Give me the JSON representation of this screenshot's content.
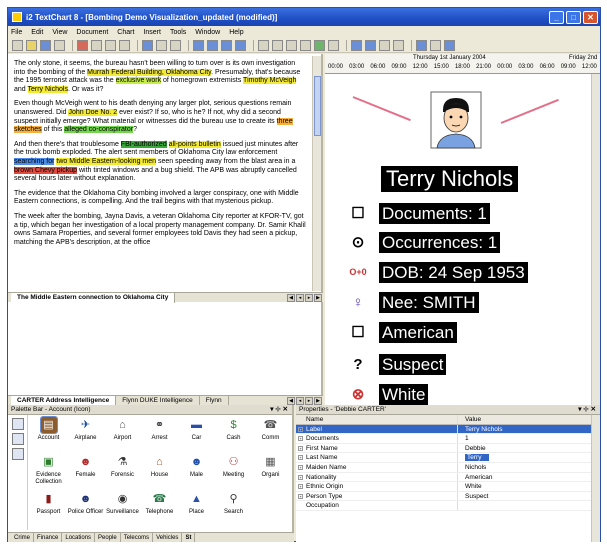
{
  "window": {
    "title": "i2 TextChart 8 - [Bombing Demo Visualization_updated (modified)]",
    "controls": [
      "_",
      "□",
      "✕"
    ]
  },
  "menu": [
    "File",
    "Edit",
    "View",
    "Document",
    "Chart",
    "Insert",
    "Tools",
    "Window",
    "Help"
  ],
  "document": {
    "para1_a": "The only stone, it seems, the bureau hasn't been willing to turn over is its own investigation into the bombing of the ",
    "para1_hl1": "Murrah Federal Building, Oklahoma City",
    "para1_b": ". Presumably, that's because the 1995 terrorist attack was the ",
    "para1_hl2": "exclusive work",
    "para1_c": " of homegrown extremists ",
    "para1_hl3": "Timothy McVeigh",
    "para1_d": " and ",
    "para1_hl4": "Terry Nichols",
    "para1_e": ". Or was it?",
    "para2_a": "Even though McVeigh went to his death denying any larger plot, serious questions remain unanswered. Did ",
    "para2_hl1": "John Doe No. 2",
    "para2_b": " ever exist? If so, who is he? If not, why did a second suspect initially emerge? What material or witnesses did the bureau use to create its ",
    "para2_hl2": "three sketches",
    "para2_c": " of this ",
    "para2_hl3": "alleged co-conspirator",
    "para2_d": "?",
    "para3_a": "And then there's that troublesome ",
    "para3_hl1": "FBI-authorized",
    "para3_b": " ",
    "para3_hl2": "all-points bulletin",
    "para3_c": " issued just minutes after the truck bomb exploded. The alert sent members of Oklahoma City law enforcement ",
    "para3_hl3": "searching for",
    "para3_d": " ",
    "para3_hl4": "two Middle Eastern-looking men",
    "para3_e": " seen speeding away from the blast area in a ",
    "para3_hl5": "brown Chevy pickup",
    "para3_f": " with tinted windows and a bug shield. The APB was abruptly cancelled several hours later without explanation.",
    "para4": "The evidence that the Oklahoma City bombing involved a larger conspiracy, one with Middle Eastern connections, is compelling. And the trail begins with that mysterious pickup.",
    "para5": "The week after the bombing, Jayna Davis, a veteran Oklahoma City reporter at KFOR-TV, got a tip, which began her investigation of a local property management company. Dr. Samir Khalil owns Samara Properties, and several former employees told Davis they had seen a pickup, matching the APB's description, at the office"
  },
  "doc_tabs": {
    "upper": "The Middle Eastern connection to Oklahoma City",
    "lower": [
      "CARTER Address Intelligence",
      "Flynn DUKE Intelligence",
      "Flynn"
    ]
  },
  "timeline": {
    "date1": "Thursday 1st January 2004",
    "date2": "Friday 2nd",
    "ticks": [
      "00:00",
      "03:00",
      "06:00",
      "09:00",
      "12:00",
      "15:00",
      "18:00",
      "21:00",
      "00:00",
      "03:00",
      "06:00",
      "09:00",
      "12:00"
    ]
  },
  "entity": {
    "name": "Terry Nichols",
    "attributes": [
      {
        "icon": "checkbox-icon",
        "glyph": "☐",
        "text": "Documents: 1"
      },
      {
        "icon": "target-icon",
        "glyph": "⊙",
        "text": "Occurrences: 1"
      },
      {
        "icon": "dob-icon",
        "glyph": "O+0",
        "text": "DOB: 24 Sep 1953"
      },
      {
        "icon": "female-symbol-icon",
        "glyph": "♀",
        "text": "Nee: SMITH"
      },
      {
        "icon": "checkbox-icon",
        "glyph": "☐",
        "text": "American"
      },
      {
        "icon": "question-icon",
        "glyph": "?",
        "text": "Suspect"
      },
      {
        "icon": "ethnic-icon",
        "glyph": "⊗",
        "text": "White"
      }
    ]
  },
  "palette": {
    "title": "Palette Bar - Account (Icon)",
    "items": [
      "Account",
      "Airplane",
      "Airport",
      "Arrest",
      "Car",
      "Cash",
      "Comm",
      "Evidence Collection",
      "Female",
      "Forensic",
      "House",
      "Male",
      "Meeting",
      "Organi",
      "Passport",
      "Police Officer",
      "Surveillance",
      "Telephone",
      "Place",
      "Search",
      ""
    ],
    "tabs": [
      "Crime",
      "Finance",
      "Locations",
      "People",
      "Telecoms",
      "Vehicles",
      "St"
    ]
  },
  "properties": {
    "title": "Properties - 'Debbie CARTER'",
    "col_name": "Name",
    "col_value": "Value",
    "rows": [
      {
        "name": "Label",
        "value": "Terry Nichols"
      },
      {
        "name": "Documents",
        "value": "1"
      },
      {
        "name": "First Name",
        "value": "Debbie"
      },
      {
        "name": "Last Name",
        "value": "Terry"
      },
      {
        "name": "Maiden Name",
        "value": "Nichols"
      },
      {
        "name": "Nationality",
        "value": "American"
      },
      {
        "name": "Ethnic Origin",
        "value": "White"
      },
      {
        "name": "Person Type",
        "value": "Suspect"
      },
      {
        "name": "Occupation",
        "value": ""
      }
    ]
  }
}
